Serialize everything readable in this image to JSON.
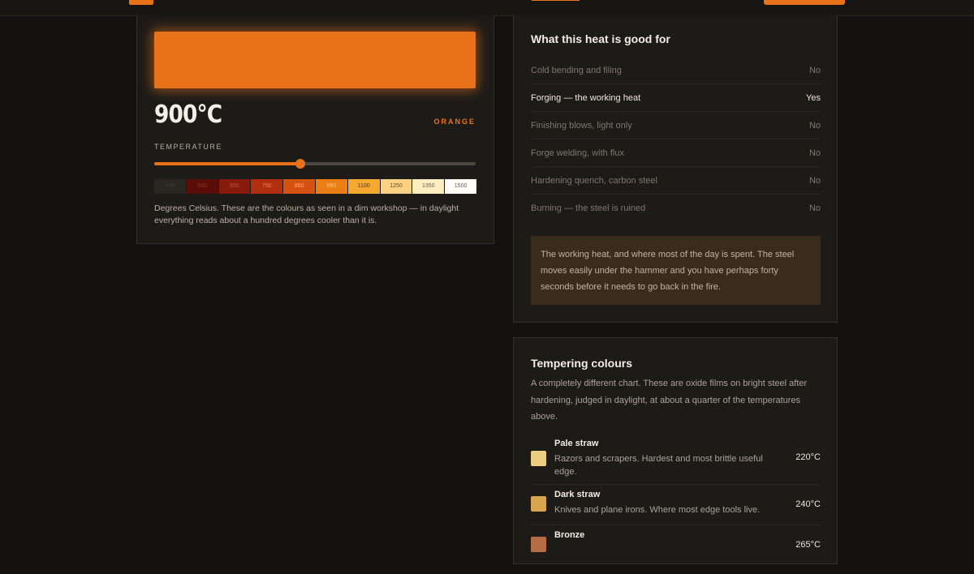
{
  "header": {
    "colors": {
      "accent": "#e8711a"
    }
  },
  "heat_panel": {
    "temperature_display": "900°C",
    "color_name": "ORANGE",
    "temperature_label": "TEMPERATURE",
    "slider": {
      "min": 400,
      "max": 1500,
      "value": 900
    },
    "scale": [
      {
        "label": "400",
        "color": "#2a2622",
        "text_color": "#3e3a35"
      },
      {
        "label": "550",
        "color": "#5a0d06",
        "text_color": "#8a3a2c"
      },
      {
        "label": "650",
        "color": "#861a0b",
        "text_color": "#c05a3c"
      },
      {
        "label": "750",
        "color": "#b12e0e",
        "text_color": "#e88a5c"
      },
      {
        "label": "850",
        "color": "#d55212",
        "text_color": "#f9b27a"
      },
      {
        "label": "950",
        "color": "#ec7e16",
        "text_color": "#fcd09a"
      },
      {
        "label": "1100",
        "color": "#f5a931",
        "text_color": "#5a3a10"
      },
      {
        "label": "1250",
        "color": "#fbd283",
        "text_color": "#6b5024"
      },
      {
        "label": "1350",
        "color": "#fdeec2",
        "text_color": "#6d6048"
      },
      {
        "label": "1500",
        "color": "#fffdf5",
        "text_color": "#6a665e"
      }
    ],
    "caption": "Degrees Celsius. These are the colours as seen in a dim workshop — in daylight everything reads about a hundred degrees cooler than it is."
  },
  "good_for": {
    "title": "What this heat is good for",
    "rows": [
      {
        "label": "Cold bending and filing",
        "value": "No",
        "active": false
      },
      {
        "label": "Forging — the working heat",
        "value": "Yes",
        "active": true
      },
      {
        "label": "Finishing blows, light only",
        "value": "No",
        "active": false
      },
      {
        "label": "Forge welding, with flux",
        "value": "No",
        "active": false
      },
      {
        "label": "Hardening quench, carbon steel",
        "value": "No",
        "active": false
      },
      {
        "label": "Burning — the steel is ruined",
        "value": "No",
        "active": false
      }
    ],
    "note": "The working heat, and where most of the day is spent. The steel moves easily under the hammer and you have perhaps forty seconds before it needs to go back in the fire."
  },
  "tempering": {
    "title": "Tempering colours",
    "intro": "A completely different chart. These are oxide films on bright steel after hardening, judged in daylight, at about a quarter of the temperatures above.",
    "items": [
      {
        "name": "Pale straw",
        "desc": "Razors and scrapers. Hardest and most brittle useful edge.",
        "temp": "220°C",
        "color": "#ecce82"
      },
      {
        "name": "Dark straw",
        "desc": "Knives and plane irons. Where most edge tools live.",
        "temp": "240°C",
        "color": "#d9a54c"
      },
      {
        "name": "Bronze",
        "desc": "",
        "temp": "265°C",
        "color": "#b86e45"
      }
    ]
  }
}
